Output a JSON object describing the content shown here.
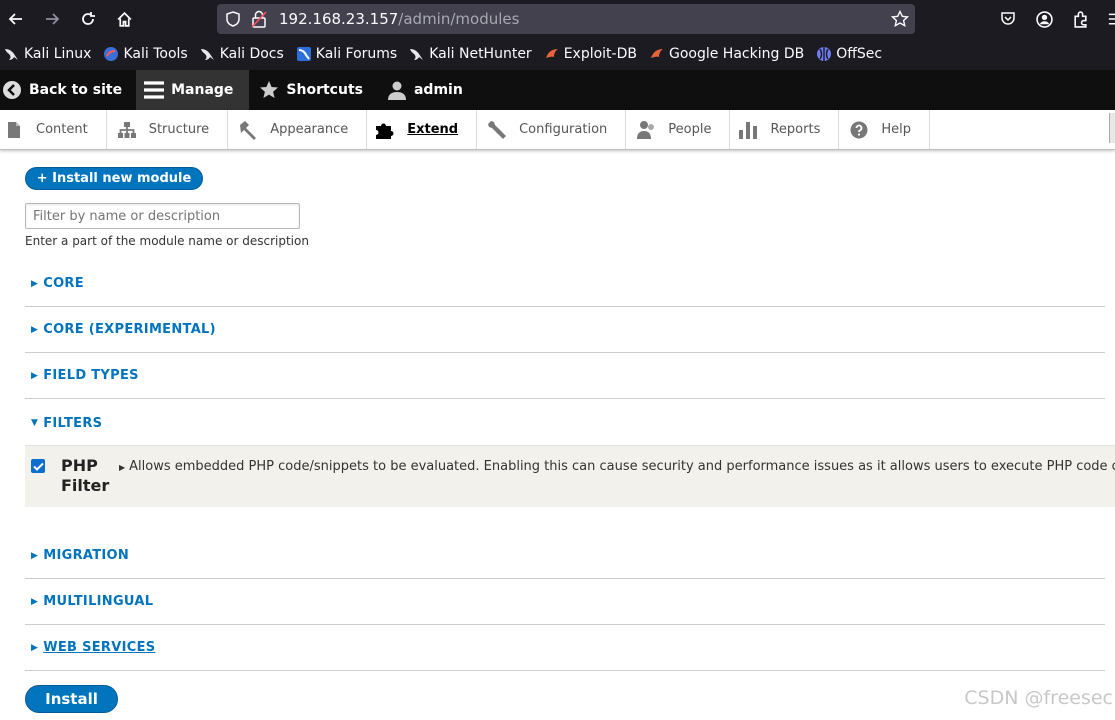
{
  "browser": {
    "url_host": "192.168.23.157",
    "url_path": "/admin/modules",
    "bookmarks": [
      {
        "label": "Kali Linux",
        "icon": "kali-dragon-icon"
      },
      {
        "label": "Kali Tools",
        "icon": "kali-tools-icon"
      },
      {
        "label": "Kali Docs",
        "icon": "kali-dragon-icon"
      },
      {
        "label": "Kali Forums",
        "icon": "kali-forums-icon"
      },
      {
        "label": "Kali NetHunter",
        "icon": "kali-dragon-icon"
      },
      {
        "label": "Exploit-DB",
        "icon": "exploitdb-icon"
      },
      {
        "label": "Google Hacking DB",
        "icon": "exploitdb-icon"
      },
      {
        "label": "OffSec",
        "icon": "offsec-icon"
      }
    ]
  },
  "admin_toolbar": {
    "back_to_site": "Back to site",
    "manage": "Manage",
    "shortcuts": "Shortcuts",
    "user": "admin"
  },
  "tray": {
    "items": [
      "Content",
      "Structure",
      "Appearance",
      "Extend",
      "Configuration",
      "People",
      "Reports",
      "Help"
    ],
    "active": "Extend"
  },
  "page": {
    "install_new_module": "+ Install new module",
    "filter_placeholder": "Filter by name or description",
    "filter_description": "Enter a part of the module name or description",
    "sections": [
      "CORE",
      "CORE (EXPERIMENTAL)",
      "FIELD TYPES",
      "FILTERS",
      "MIGRATION",
      "MULTILINGUAL",
      "WEB SERVICES"
    ],
    "module": {
      "name": "PHP Filter",
      "checked": true,
      "description": "Allows embedded PHP code/snippets to be evaluated. Enabling this can cause security and performance issues as it allows users to execute PHP code o"
    },
    "install_button": "Install"
  },
  "watermark": "CSDN @freesec",
  "colors": {
    "accent": "#0074bd",
    "toolbar_dark": "#0f0f0f",
    "browser_chrome": "#1c1b22",
    "module_row_bg": "#f2f1eb"
  }
}
